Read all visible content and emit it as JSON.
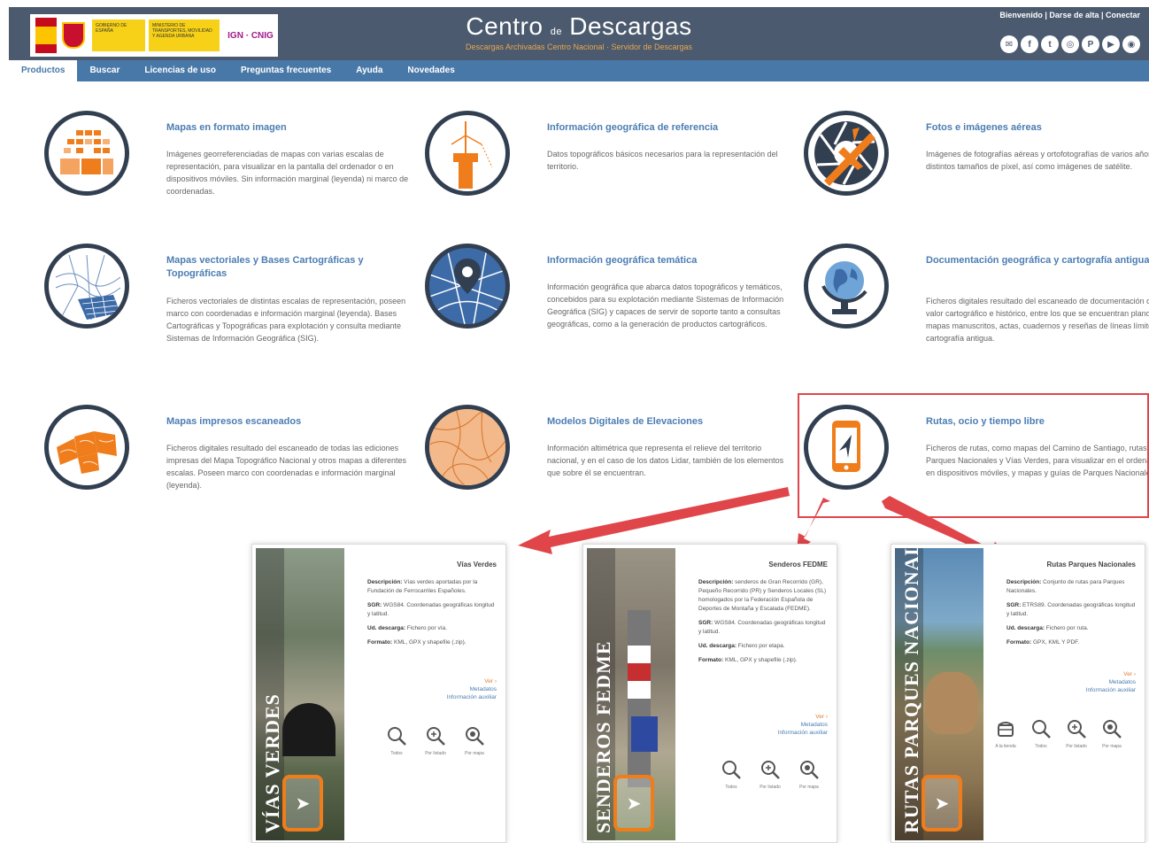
{
  "header": {
    "title_main_1": "Centro",
    "title_small": "de",
    "title_main_2": "Descargas",
    "subtitle": "Descargas Archivadas Centro Nacional   ·   Servidor de Descargas",
    "top_links": "Bienvenido | Darse de alta | Conectar",
    "gov_text": "GOBIERNO DE ESPAÑA",
    "ministry_text": "MINISTERIO DE TRANSPORTES, MOVILIDAD Y AGENDA URBANA",
    "ign_text": "IGN · CNIG",
    "socials": [
      "✉",
      "f",
      "t",
      "◎",
      "P",
      "▶",
      "◉"
    ]
  },
  "nav": {
    "items": [
      "Productos",
      "Buscar",
      "Licencias de uso",
      "Preguntas frecuentes",
      "Ayuda",
      "Novedades"
    ]
  },
  "products": [
    {
      "title": "Mapas en formato imagen",
      "desc": "Imágenes georreferenciadas de mapas con varias escalas de representación, para visualizar en la pantalla del ordenador o en dispositivos móviles. Sin información marginal (leyenda) ni marco de coordenadas."
    },
    {
      "title": "Información geográfica de referencia",
      "desc": "Datos topográficos básicos necesarios para la representación del territorio."
    },
    {
      "title": "Fotos e imágenes aéreas",
      "desc": "Imágenes de fotografías aéreas y ortofotografías de varios años y con distintos tamaños de píxel, así como imágenes de satélite."
    },
    {
      "title": "Mapas vectoriales y Bases Cartográficas y Topográficas",
      "desc": "Ficheros vectoriales de distintas escalas de representación, poseen marco con coordenadas e información marginal (leyenda). Bases Cartográficas y Topográficas para explotación y consulta mediante Sistemas de Información Geográfica (SIG)."
    },
    {
      "title": "Información geográfica temática",
      "desc": "Información geográfica que abarca datos topográficos y temáticos, concebidos para su explotación mediante Sistemas de Información Geográfica (SIG) y capaces de servir de soporte tanto a consultas geográficas, como a la generación de productos cartográficos."
    },
    {
      "title": "Documentación geográfica y cartografía antigua",
      "desc": "Ficheros digitales resultado del escaneado de documentación de gran valor cartográfico e histórico, entre los que se encuentran planos y mapas manuscritos, actas, cuadernos y reseñas de líneas límite y cartografía antigua."
    },
    {
      "title": "Mapas impresos escaneados",
      "desc": "Ficheros digitales resultado del escaneado de todas las ediciones impresas del Mapa Topográfico Nacional y otros mapas a diferentes escalas. Poseen marco con coordenadas e información marginal (leyenda)."
    },
    {
      "title": "Modelos Digitales de Elevaciones",
      "desc": "Información altimétrica que representa el relieve del territorio nacional, y en el caso de los datos Lidar, también de los elementos que sobre él se encuentran."
    },
    {
      "title": "Rutas, ocio y tiempo libre",
      "desc": "Ficheros de rutas, como mapas del Camino de Santiago, rutas de Parques Nacionales y Vías Verdes, para visualizar en el ordenador o en dispositivos móviles, y mapas y guías de Parques Nacionales."
    }
  ],
  "cards": [
    {
      "vertical_title": "VÍAS VERDES",
      "name": "Vías Verdes",
      "info": [
        {
          "k": "Descripción:",
          "v": " Vías verdes aportadas por la Fundación de Ferrocarriles Españoles."
        },
        {
          "k": "SGR:",
          "v": " WGS84. Coordenadas geográficas longitud y latitud."
        },
        {
          "k": "Ud. descarga:",
          "v": " Fichero por vía."
        },
        {
          "k": "Formato:",
          "v": " KML, GPX y shapefile (.zip)."
        }
      ],
      "ver": "Ver ›",
      "metadata": "Metadatos",
      "extra_info": "Información auxiliar",
      "buttons": [
        "Todos",
        "Por listado",
        "Por mapa"
      ]
    },
    {
      "vertical_title": "SENDEROS FEDME",
      "name": "Senderos FEDME",
      "info": [
        {
          "k": "Descripción:",
          "v": " senderos de Gran Recorrido (GR), Pequeño Recorrido (PR) y Senderos Locales (SL) homologados por la Federación Española de Deportes de Montaña y Escalada (FEDME)."
        },
        {
          "k": "SGR:",
          "v": " WGS84. Coordenadas geográficas longitud y latitud."
        },
        {
          "k": "Ud. descarga:",
          "v": " Fichero por etapa."
        },
        {
          "k": "Formato:",
          "v": " KML, GPX y shapefile (.zip)."
        }
      ],
      "ver": "Ver ›",
      "metadata": "Metadatos",
      "extra_info": "Información auxiliar",
      "buttons": [
        "Todos",
        "Por listado",
        "Por mapa"
      ]
    },
    {
      "vertical_title": "RUTAS PARQUES NACIONALES",
      "name": "Rutas Parques Nacionales",
      "info": [
        {
          "k": "Descripción:",
          "v": " Conjunto de rutas para Parques Nacionales."
        },
        {
          "k": "SGR:",
          "v": " ETRS89. Coordenadas geográficas longitud y latitud."
        },
        {
          "k": "Ud. descarga:",
          "v": " Fichero por ruta."
        },
        {
          "k": "Formato:",
          "v": " GPX, KML Y PDF."
        }
      ],
      "ver": "Ver ›",
      "metadata": "Metadatos",
      "extra_info": "Información auxiliar",
      "buttons": [
        "A la tienda",
        "Todos",
        "Por listado",
        "Por mapa"
      ]
    }
  ],
  "colors": {
    "header_bg": "#4b5a6e",
    "nav_bg": "#4878a8",
    "accent_orange": "#f07d1c",
    "title_blue": "#4b7db3",
    "icon_ring": "#323f50",
    "highlight_red": "#e0454a"
  },
  "icons": [
    "grid-map-icon",
    "surveying-icon",
    "camera-plane-icon",
    "vector-map-icon",
    "map-pin-icon",
    "globe-icon",
    "scanned-map-icon",
    "elevation-icon",
    "phone-route-icon"
  ]
}
